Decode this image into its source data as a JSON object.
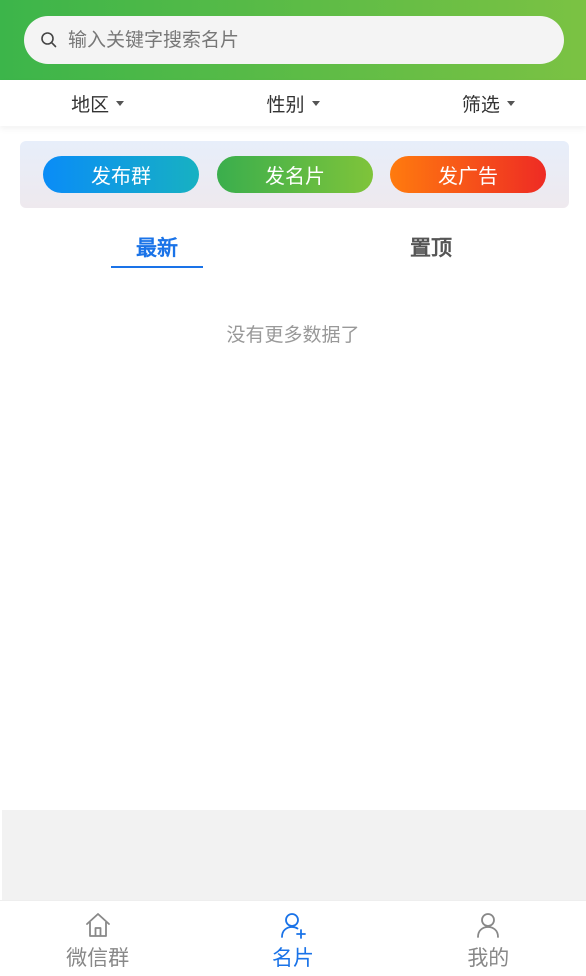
{
  "search": {
    "placeholder": "输入关键字搜索名片"
  },
  "filters": [
    {
      "label": "地区"
    },
    {
      "label": "性别"
    },
    {
      "label": "筛选"
    }
  ],
  "actions": {
    "publish_group": "发布群",
    "publish_card": "发名片",
    "publish_ad": "发广告"
  },
  "tabs": {
    "latest": "最新",
    "pinned": "置顶",
    "active": "latest"
  },
  "list": {
    "empty_text": "没有更多数据了"
  },
  "tabbar": {
    "items": [
      {
        "label": "微信群",
        "icon": "home-icon"
      },
      {
        "label": "名片",
        "icon": "user-add-icon"
      },
      {
        "label": "我的",
        "icon": "user-icon"
      }
    ],
    "active_index": 1
  },
  "colors": {
    "header_start": "#3cb54a",
    "header_end": "#7bc243",
    "accent": "#1a73e8"
  }
}
